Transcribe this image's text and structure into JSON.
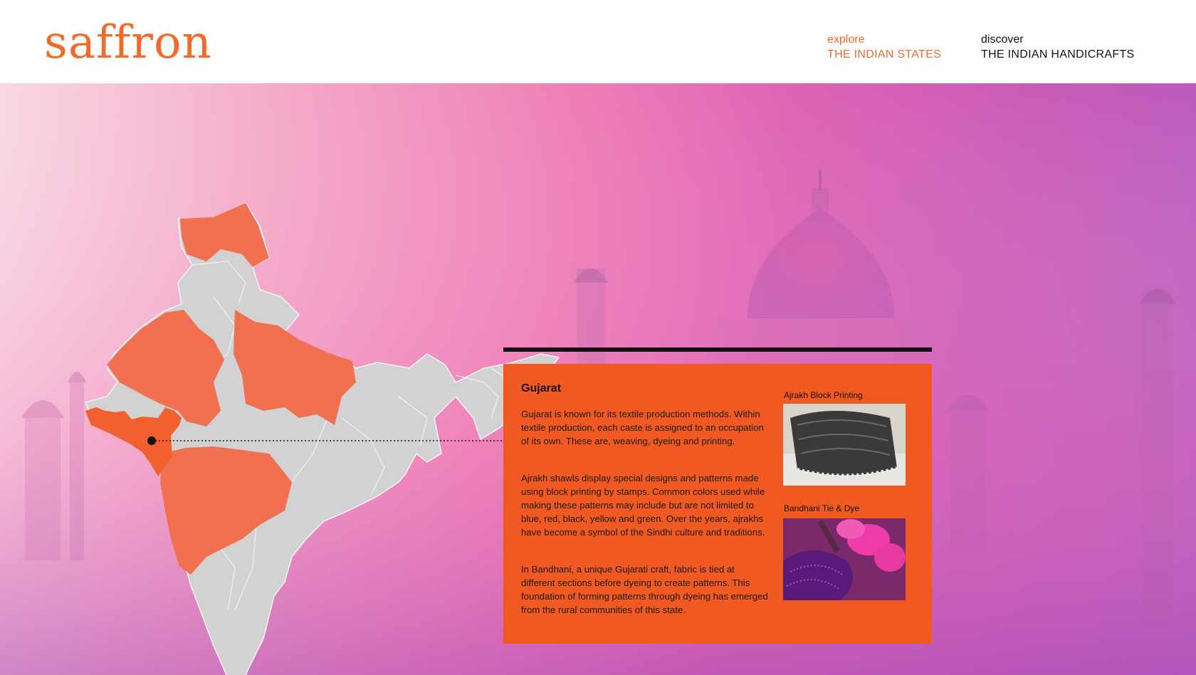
{
  "brand": {
    "logo_text": "saffron",
    "color": "#f26a2a"
  },
  "nav": {
    "explore": {
      "small": "explore",
      "big": "THE INDIAN STATES"
    },
    "discover": {
      "small": "discover",
      "big": "THE INDIAN HANDICRAFTS"
    }
  },
  "map": {
    "highlight_color": "#f07050",
    "selected_color": "#f26030",
    "base_color": "#d2d2d2"
  },
  "panel": {
    "title": "Gujarat",
    "paragraphs": [
      "Gujarat is known for its textile production methods. Within textile production, each caste is assigned to an occupation of its own. These are, weaving, dyeing and printing.",
      "Ajrakh shawls display special designs and patterns made using block printing by stamps. Common colors used while making these patterns may include but are not limited to blue, red, black, yellow and green. Over the years, ajrakhs have become a symbol of the Sindhi culture and traditions.",
      "In Bandhani, a unique Gujarati craft, fabric is tied at different sections before dyeing to create patterns. This foundation of forming patterns through dyeing has emerged from the rural communities of this state."
    ],
    "crafts": [
      {
        "caption": "Ajrakh Block Printing"
      },
      {
        "caption": "Bandhani Tie & Dye"
      }
    ],
    "color": "#f05a22"
  }
}
